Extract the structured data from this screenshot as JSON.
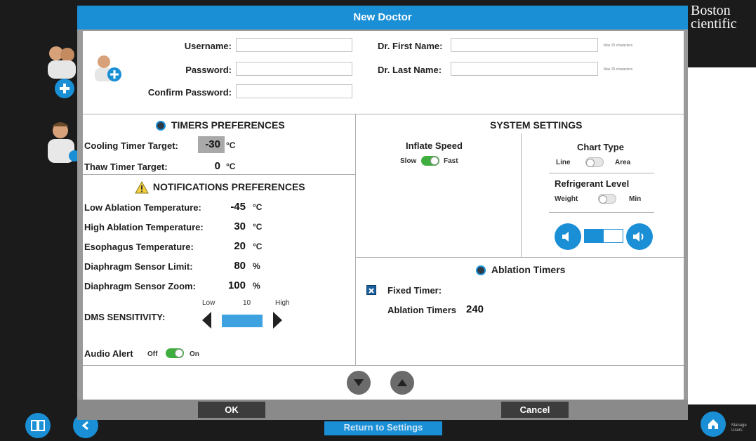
{
  "brand": "Boston cientific",
  "background": {
    "return_label": "Return to Settings",
    "manage_users_label": "Manage Users"
  },
  "dialog": {
    "title": "New Doctor",
    "account": {
      "username_label": "Username:",
      "password_label": "Password:",
      "confirm_password_label": "Confirm Password:",
      "first_name_label": "Dr. First Name:",
      "last_name_label": "Dr. Last Name:",
      "first_name_hint": "Max 25 characters",
      "last_name_hint": "Max 25 characters",
      "username_value": "",
      "password_value": "",
      "confirm_password_value": "",
      "first_name_value": "",
      "last_name_value": ""
    },
    "timers": {
      "title": "TIMERS PREFERENCES",
      "cooling_label": "Cooling Timer Target:",
      "cooling_value": "-30",
      "cooling_unit": "°C",
      "thaw_label": "Thaw Timer Target:",
      "thaw_value": "0",
      "thaw_unit": "°C"
    },
    "notifications": {
      "title": "NOTIFICATIONS PREFERENCES",
      "rows": [
        {
          "label": "Low Ablation Temperature:",
          "value": "-45",
          "unit": "°C"
        },
        {
          "label": "High Ablation Temperature:",
          "value": "30",
          "unit": "°C"
        },
        {
          "label": "Esophagus Temperature:",
          "value": "20",
          "unit": "°C"
        },
        {
          "label": "Diaphragm Sensor Limit:",
          "value": "80",
          "unit": "%"
        },
        {
          "label": "Diaphragm Sensor Zoom:",
          "value": "100",
          "unit": "%"
        }
      ],
      "dms_label": "DMS SENSITIVITY:",
      "dms_low": "Low",
      "dms_value": "10",
      "dms_high": "High",
      "audio_label": "Audio Alert",
      "audio_off": "Off",
      "audio_on": "On"
    },
    "system": {
      "title": "SYSTEM SETTINGS",
      "inflate_title": "Inflate Speed",
      "inflate_slow": "Slow",
      "inflate_fast": "Fast",
      "chart_title": "Chart Type",
      "chart_line": "Line",
      "chart_area": "Area",
      "refrigerant_title": "Refrigerant Level",
      "refrigerant_weight": "Weight",
      "refrigerant_min": "Min"
    },
    "ablation": {
      "title": "Ablation Timers",
      "fixed_label": "Fixed Timer:",
      "fixed_checked": true,
      "timers_label": "Ablation Timers",
      "timers_value": "240"
    },
    "ok_label": "OK",
    "cancel_label": "Cancel"
  },
  "colors": {
    "accent": "#1a8fd6",
    "toggle_on": "#3fae3f",
    "dialog_gray": "#9a9a9a"
  }
}
